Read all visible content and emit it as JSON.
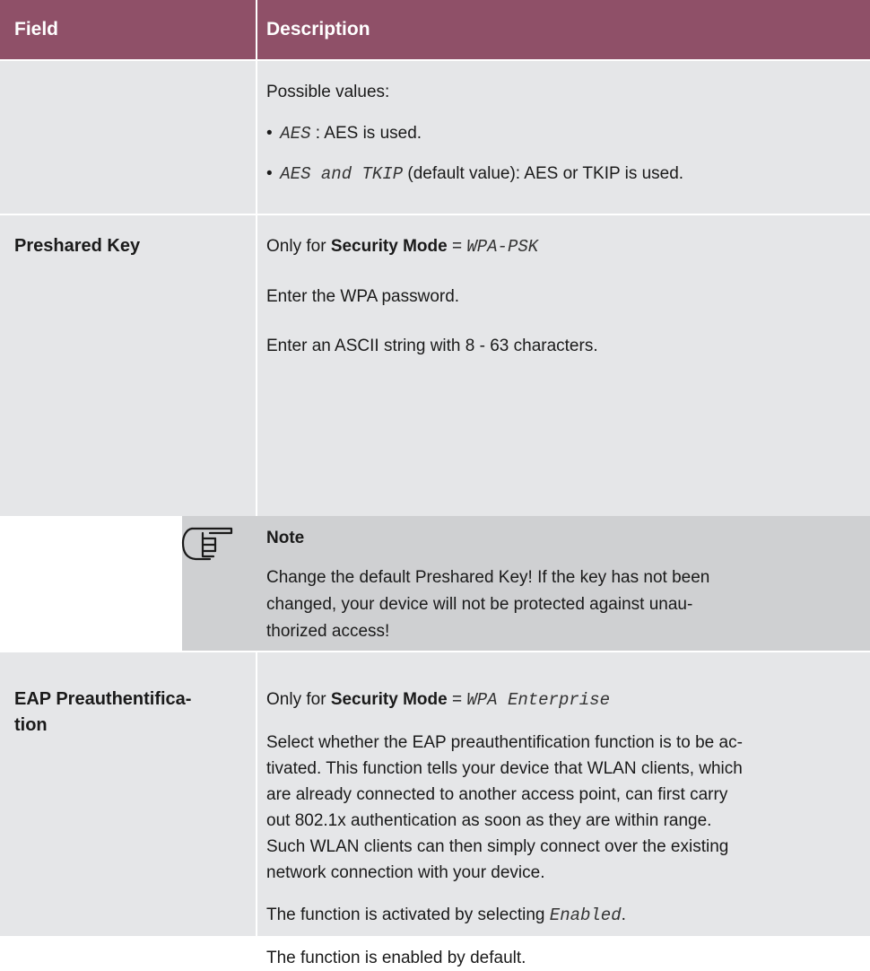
{
  "header": {
    "field_label": "Field",
    "description_label": "Description"
  },
  "rows": [
    {
      "field": "",
      "lines": {
        "possible_values": "Possible values:",
        "bullet1_value": "AES",
        "bullet1_text": " : AES is used.",
        "bullet2_value": "AES and TKIP",
        "bullet2_text": " (default value): AES or TKIP is used."
      }
    },
    {
      "field": "Preshared Key",
      "lines": {
        "only_for_prefix": "Only for ",
        "only_for_bold": "Security Mode",
        "only_for_eq": " = ",
        "only_for_value": "WPA-PSK",
        "enter_password": "Enter the WPA password.",
        "ascii": "Enter an ASCII string with 8 - 63 characters."
      }
    },
    {
      "field_line1": "EAP Preauthentifica-",
      "field_line2": "tion",
      "lines": {
        "only_for_prefix": "Only for ",
        "only_for_bold": "Security Mode",
        "only_for_eq": " = ",
        "only_for_value": "WPA Enterprise",
        "para1_l1": "Select whether the EAP preauthentification function is to be ac-",
        "para1_l2": "tivated. This function tells your device that WLAN clients, which",
        "para1_l3": "are already connected to another access point, can first carry",
        "para1_l4": "out 802.1x authentication as soon as they are within range.",
        "para1_l5": "Such WLAN clients can then simply connect over the existing",
        "para1_l6": "network connection with your device.",
        "activated_prefix": "The function is activated by selecting ",
        "activated_value": "Enabled",
        "activated_suffix": ".",
        "enabled_default": "The function is enabled by default."
      }
    }
  ],
  "note": {
    "icon": "pointing-hand-icon",
    "title": "Note",
    "line1": "Change the default Preshared Key! If the key has not been",
    "line2": "changed, your device will not be protected against unau-",
    "line3": "thorized access!"
  },
  "colors": {
    "header_bg": "#8f5068",
    "row_bg": "#e5e6e8",
    "note_bg": "#cfd0d2"
  }
}
